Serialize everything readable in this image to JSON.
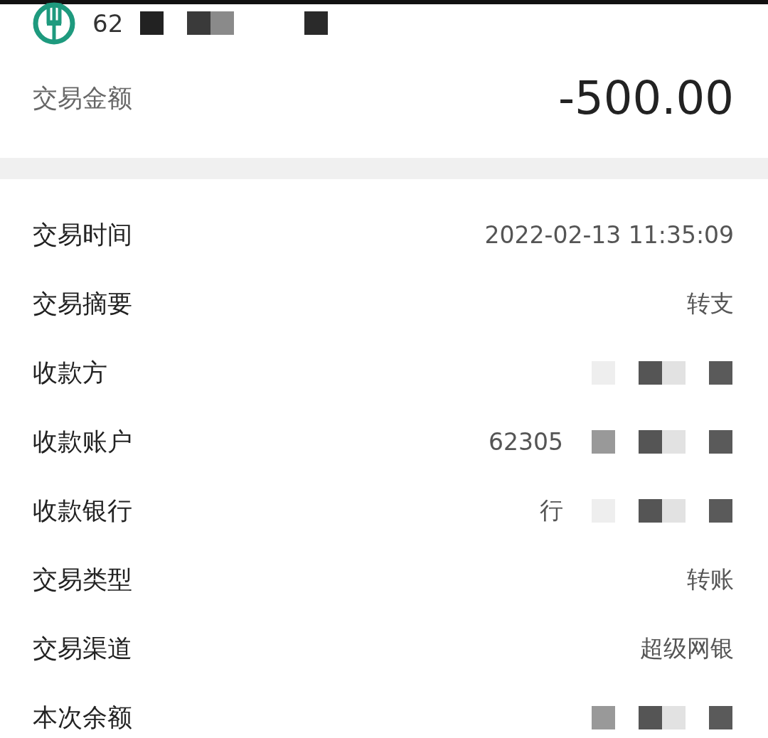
{
  "card": {
    "number": "62",
    "masked": true
  },
  "amount": {
    "label": "交易金额",
    "value": "-500.00"
  },
  "rows": [
    {
      "label": "交易时间",
      "value": "2022-02-13 11:35:09",
      "masked": false
    },
    {
      "label": "交易摘要",
      "value": "转支",
      "masked": false
    },
    {
      "label": "收款方",
      "masked": true
    },
    {
      "label": "收款账户",
      "value": "62305",
      "masked": true
    },
    {
      "label": "收款银行",
      "value": "行",
      "masked": true
    },
    {
      "label": "交易类型",
      "value": "转账",
      "masked": false
    },
    {
      "label": "交易渠道",
      "value": "超级网银",
      "masked": false
    },
    {
      "label": "本次余额",
      "masked": true
    }
  ]
}
